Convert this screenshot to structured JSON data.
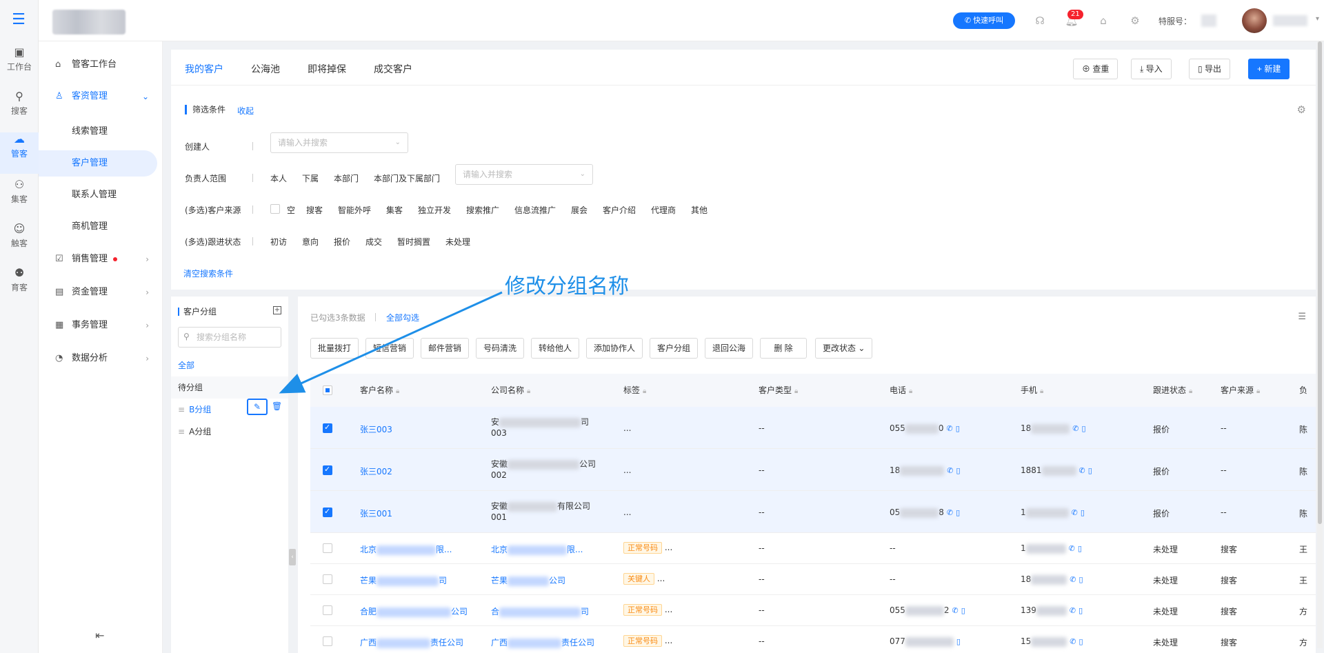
{
  "rail": {
    "items": [
      {
        "label": "工作台",
        "icon": "desktop-icon"
      },
      {
        "label": "搜客",
        "icon": "search-user-icon"
      },
      {
        "label": "管客",
        "icon": "crm-cloud-icon"
      },
      {
        "label": "集客",
        "icon": "group-users-icon"
      },
      {
        "label": "触客",
        "icon": "headset-user-icon"
      },
      {
        "label": "育客",
        "icon": "nurture-users-icon"
      }
    ]
  },
  "header": {
    "call_button": "快速呼叫",
    "notify_count": "21",
    "service_label": "特服号："
  },
  "sidebar": {
    "workbench": "管客工作台",
    "customer_mgmt": "客资管理",
    "sub": [
      "线索管理",
      "客户管理",
      "联系人管理",
      "商机管理"
    ],
    "sales": "销售管理",
    "funds": "资金管理",
    "affairs": "事务管理",
    "analytics": "数据分析"
  },
  "tabs": [
    "我的客户",
    "公海池",
    "即将掉保",
    "成交客户"
  ],
  "toolbar": {
    "dedupe": "查重",
    "import": "导入",
    "export": "导出",
    "create": "+ 新建"
  },
  "filter": {
    "title": "筛选条件",
    "collapse": "收起",
    "creator_label": "创建人",
    "creator_placeholder": "请输入并搜索",
    "owner_label": "负责人范围",
    "owner_options": [
      "本人",
      "下属",
      "本部门",
      "本部门及下属部门"
    ],
    "owner_placeholder": "请输入并搜索",
    "source_label": "(多选)客户来源",
    "source_options": [
      "空",
      "搜客",
      "智能外呼",
      "集客",
      "独立开发",
      "搜索推广",
      "信息流推广",
      "展会",
      "客户介绍",
      "代理商",
      "其他"
    ],
    "status_label": "(多选)跟进状态",
    "status_options": [
      "初访",
      "意向",
      "报价",
      "成交",
      "暂时搁置",
      "未处理"
    ],
    "clear": "清空搜索条件"
  },
  "groups": {
    "title": "客户分组",
    "search_placeholder": "搜索分组名称",
    "items": [
      "全部",
      "待分组",
      "B分组",
      "A分组"
    ]
  },
  "annotation": "修改分组名称",
  "table": {
    "selected_info": "已勾选3条数据",
    "select_all": "全部勾选",
    "actions": [
      "批量拨打",
      "短信营销",
      "邮件营销",
      "号码清洗",
      "转给他人",
      "添加协作人",
      "客户分组",
      "退回公海",
      "删 除",
      "更改状态"
    ],
    "columns": [
      "客户名称",
      "公司名称",
      "标签",
      "客户类型",
      "电话",
      "手机",
      "跟进状态",
      "客户来源",
      "负"
    ],
    "rows": [
      {
        "name": "张三003",
        "company_a": "安",
        "company_b": "司",
        "company_line2": "003",
        "tag": "...",
        "type": "--",
        "tel_a": "055",
        "tel_b": "0",
        "mobile_a": "18",
        "status": "报价",
        "source": "--",
        "owner": "陈"
      },
      {
        "name": "张三002",
        "company_a": "安徽",
        "company_b": "公司",
        "company_line2": "002",
        "tag": "...",
        "type": "--",
        "tel_a": "18",
        "tel_b": "",
        "mobile_a": "1881",
        "status": "报价",
        "source": "--",
        "owner": "陈"
      },
      {
        "name": "张三001",
        "company_a": "安徽",
        "company_b": "有限公司",
        "company_line2": "001",
        "tag": "...",
        "type": "--",
        "tel_a": "05",
        "tel_b": "8",
        "mobile_a": "1",
        "status": "报价",
        "source": "--",
        "owner": "陈"
      },
      {
        "name_a": "北京",
        "name_b": "限...",
        "company_a": "北京",
        "company_b": "限...",
        "tag": "正常号码",
        "tag_more": "...",
        "type": "--",
        "tel": "--",
        "mobile_a": "1",
        "status": "未处理",
        "source": "搜客",
        "owner": "王"
      },
      {
        "name_a": "芒果",
        "name_b": "司",
        "company_a": "芒果",
        "company_b": "公司",
        "tag": "关键人",
        "tag_more": "...",
        "type": "--",
        "tel": "--",
        "mobile_a": "18",
        "status": "未处理",
        "source": "搜客",
        "owner": "王"
      },
      {
        "name_a": "合肥",
        "name_b": "公司",
        "company_a": "合",
        "company_b": "司",
        "tag": "正常号码",
        "tag_more": "...",
        "type": "--",
        "tel_a": "055",
        "tel_b": "2",
        "mobile_a": "139",
        "status": "未处理",
        "source": "搜客",
        "owner": "方"
      },
      {
        "name_a": "广西",
        "name_b": "责任公司",
        "company_a": "广西",
        "company_b": "责任公司",
        "tag": "正常号码",
        "tag_more": "...",
        "type": "--",
        "tel_a": "077",
        "tel_b": "",
        "mobile_a": "15",
        "status": "未处理",
        "source": "搜客",
        "owner": "方"
      }
    ]
  },
  "colors": {
    "accent": "#1677ff",
    "tag_orange": "#fa8c16",
    "annotation": "#1e8fe8"
  }
}
